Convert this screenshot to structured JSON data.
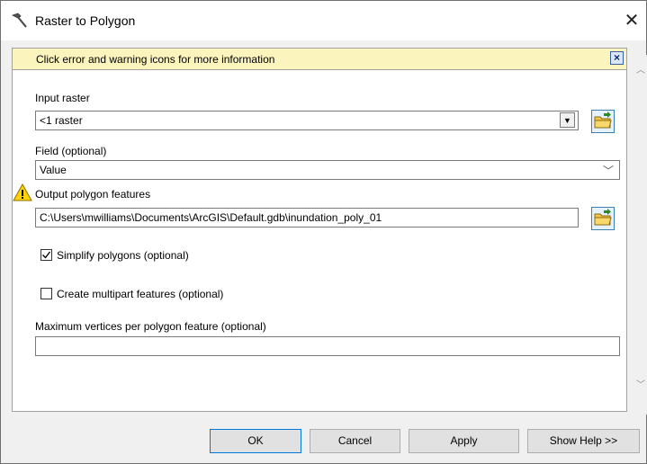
{
  "window": {
    "title": "Raster to Polygon"
  },
  "info_bar": {
    "text": "Click error and warning icons for more information"
  },
  "input_raster": {
    "label": "Input raster",
    "value": "<1 raster"
  },
  "field": {
    "label": "Field (optional)",
    "value": "Value"
  },
  "output_polygon": {
    "label": "Output polygon features",
    "value": "C:\\Users\\mwilliams\\Documents\\ArcGIS\\Default.gdb\\inundation_poly_01"
  },
  "simplify": {
    "label": "Simplify polygons (optional)",
    "checked": true
  },
  "multipart": {
    "label": "Create multipart features (optional)",
    "checked": false
  },
  "max_vertices": {
    "label": "Maximum vertices per polygon feature (optional)",
    "value": ""
  },
  "buttons": {
    "ok": "OK",
    "cancel": "Cancel",
    "apply": "Apply",
    "help": "Show Help >>"
  }
}
